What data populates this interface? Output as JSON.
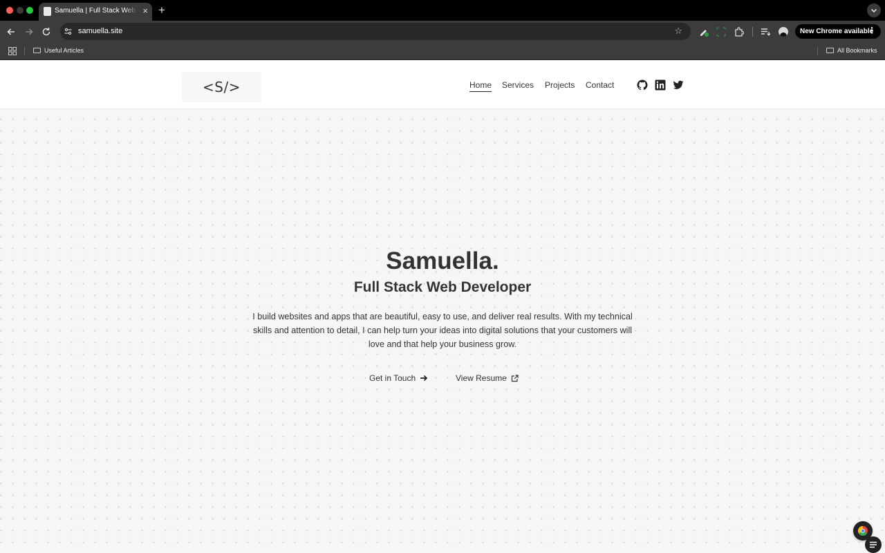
{
  "browser": {
    "tab_title": "Samuella | Full Stack Web Developer",
    "tab_close": "×",
    "new_tab": "+",
    "url": "samuella.site",
    "update_label": "New Chrome available",
    "update_menu": "⋮",
    "bookmarks": [
      {
        "label": "Useful Articles"
      }
    ],
    "all_bookmarks_label": "All Bookmarks"
  },
  "site": {
    "logo": "<S/>",
    "nav": [
      {
        "label": "Home",
        "active": true
      },
      {
        "label": "Services"
      },
      {
        "label": "Projects"
      },
      {
        "label": "Contact"
      }
    ],
    "social_icons": [
      "github-icon",
      "linkedin-icon",
      "twitter-icon"
    ],
    "hero": {
      "name": "Samuella.",
      "role": "Full Stack Web Developer",
      "description": "I build websites and apps that are beautiful, easy to use, and deliver real results. With my technical skills and attention to detail, I can help turn your ideas into digital solutions that your customers will love and that help your business grow.",
      "cta_primary": "Get in Touch",
      "cta_secondary": "View Resume"
    }
  },
  "colors": {
    "page_bg": "#f6f6f6",
    "header_bg": "#ffffff",
    "text": "#333333",
    "chrome_dark": "#3c3c3c",
    "tab_bar": "#000000"
  }
}
